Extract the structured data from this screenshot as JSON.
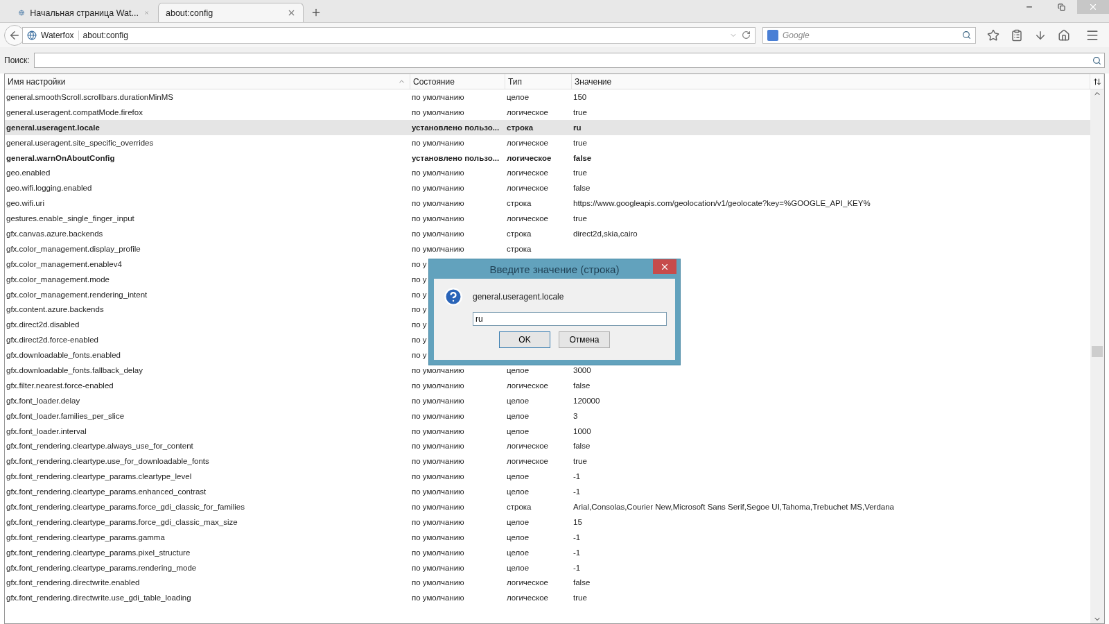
{
  "tabs": [
    {
      "label": "Начальная страница Wat...",
      "selected": false
    },
    {
      "label": "about:config",
      "selected": true
    }
  ],
  "navbar": {
    "identity": "Waterfox",
    "url": "about:config",
    "search_placeholder": "Google"
  },
  "filter": {
    "label": "Поиск:"
  },
  "table": {
    "columns": [
      {
        "label": "Имя настройки",
        "sorted": true
      },
      {
        "label": "Состояние",
        "sorted": false
      },
      {
        "label": "Тип",
        "sorted": false
      },
      {
        "label": "Значение",
        "sorted": false
      }
    ],
    "rows": [
      {
        "name": "general.smoothScroll.scrollbars.durationMinMS",
        "state": "по умолчанию",
        "type": "целое",
        "value": "150",
        "modified": false,
        "selected": false
      },
      {
        "name": "general.useragent.compatMode.firefox",
        "state": "по умолчанию",
        "type": "логическое",
        "value": "true",
        "modified": false,
        "selected": false
      },
      {
        "name": "general.useragent.locale",
        "state": "установлено пользо...",
        "type": "строка",
        "value": "ru",
        "modified": true,
        "selected": true
      },
      {
        "name": "general.useragent.site_specific_overrides",
        "state": "по умолчанию",
        "type": "логическое",
        "value": "true",
        "modified": false,
        "selected": false
      },
      {
        "name": "general.warnOnAboutConfig",
        "state": "установлено пользо...",
        "type": "логическое",
        "value": "false",
        "modified": true,
        "selected": false
      },
      {
        "name": "geo.enabled",
        "state": "по умолчанию",
        "type": "логическое",
        "value": "true",
        "modified": false,
        "selected": false
      },
      {
        "name": "geo.wifi.logging.enabled",
        "state": "по умолчанию",
        "type": "логическое",
        "value": "false",
        "modified": false,
        "selected": false
      },
      {
        "name": "geo.wifi.uri",
        "state": "по умолчанию",
        "type": "строка",
        "value": "https://www.googleapis.com/geolocation/v1/geolocate?key=%GOOGLE_API_KEY%",
        "modified": false,
        "selected": false
      },
      {
        "name": "gestures.enable_single_finger_input",
        "state": "по умолчанию",
        "type": "логическое",
        "value": "true",
        "modified": false,
        "selected": false
      },
      {
        "name": "gfx.canvas.azure.backends",
        "state": "по умолчанию",
        "type": "строка",
        "value": "direct2d,skia,cairo",
        "modified": false,
        "selected": false
      },
      {
        "name": "gfx.color_management.display_profile",
        "state": "по умолчанию",
        "type": "строка",
        "modified": false,
        "selected": false
      },
      {
        "name": "gfx.color_management.enablev4",
        "state": "по у",
        "modified": false,
        "selected": false
      },
      {
        "name": "gfx.color_management.mode",
        "state": "по у",
        "modified": false,
        "selected": false
      },
      {
        "name": "gfx.color_management.rendering_intent",
        "state": "по у",
        "modified": false,
        "selected": false
      },
      {
        "name": "gfx.content.azure.backends",
        "state": "по у",
        "modified": false,
        "selected": false
      },
      {
        "name": "gfx.direct2d.disabled",
        "state": "по у",
        "modified": false,
        "selected": false
      },
      {
        "name": "gfx.direct2d.force-enabled",
        "state": "по у",
        "modified": false,
        "selected": false
      },
      {
        "name": "gfx.downloadable_fonts.enabled",
        "state": "по у",
        "modified": false,
        "selected": false
      },
      {
        "name": "gfx.downloadable_fonts.fallback_delay",
        "state": "по умолчанию",
        "type": "целое",
        "value": "3000",
        "modified": false,
        "selected": false
      },
      {
        "name": "gfx.filter.nearest.force-enabled",
        "state": "по умолчанию",
        "type": "логическое",
        "value": "false",
        "modified": false,
        "selected": false
      },
      {
        "name": "gfx.font_loader.delay",
        "state": "по умолчанию",
        "type": "целое",
        "value": "120000",
        "modified": false,
        "selected": false
      },
      {
        "name": "gfx.font_loader.families_per_slice",
        "state": "по умолчанию",
        "type": "целое",
        "value": "3",
        "modified": false,
        "selected": false
      },
      {
        "name": "gfx.font_loader.interval",
        "state": "по умолчанию",
        "type": "целое",
        "value": "1000",
        "modified": false,
        "selected": false
      },
      {
        "name": "gfx.font_rendering.cleartype.always_use_for_content",
        "state": "по умолчанию",
        "type": "логическое",
        "value": "false",
        "modified": false,
        "selected": false
      },
      {
        "name": "gfx.font_rendering.cleartype.use_for_downloadable_fonts",
        "state": "по умолчанию",
        "type": "логическое",
        "value": "true",
        "modified": false,
        "selected": false
      },
      {
        "name": "gfx.font_rendering.cleartype_params.cleartype_level",
        "state": "по умолчанию",
        "type": "целое",
        "value": "-1",
        "modified": false,
        "selected": false
      },
      {
        "name": "gfx.font_rendering.cleartype_params.enhanced_contrast",
        "state": "по умолчанию",
        "type": "целое",
        "value": "-1",
        "modified": false,
        "selected": false
      },
      {
        "name": "gfx.font_rendering.cleartype_params.force_gdi_classic_for_families",
        "state": "по умолчанию",
        "type": "строка",
        "value": "Arial,Consolas,Courier New,Microsoft Sans Serif,Segoe UI,Tahoma,Trebuchet MS,Verdana",
        "modified": false,
        "selected": false
      },
      {
        "name": "gfx.font_rendering.cleartype_params.force_gdi_classic_max_size",
        "state": "по умолчанию",
        "type": "целое",
        "value": "15",
        "modified": false,
        "selected": false
      },
      {
        "name": "gfx.font_rendering.cleartype_params.gamma",
        "state": "по умолчанию",
        "type": "целое",
        "value": "-1",
        "modified": false,
        "selected": false
      },
      {
        "name": "gfx.font_rendering.cleartype_params.pixel_structure",
        "state": "по умолчанию",
        "type": "целое",
        "value": "-1",
        "modified": false,
        "selected": false
      },
      {
        "name": "gfx.font_rendering.cleartype_params.rendering_mode",
        "state": "по умолчанию",
        "type": "целое",
        "value": "-1",
        "modified": false,
        "selected": false
      },
      {
        "name": "gfx.font_rendering.directwrite.enabled",
        "state": "по умолчанию",
        "type": "логическое",
        "value": "false",
        "modified": false,
        "selected": false
      },
      {
        "name": "gfx.font_rendering.directwrite.use_gdi_table_loading",
        "state": "по умолчанию",
        "type": "логическое",
        "value": "true",
        "modified": false,
        "selected": false
      }
    ]
  },
  "dialog": {
    "title": "Введите значение (строка)",
    "message": "general.useragent.locale",
    "value": "ru",
    "buttons": [
      "OK",
      "Отмена"
    ]
  }
}
